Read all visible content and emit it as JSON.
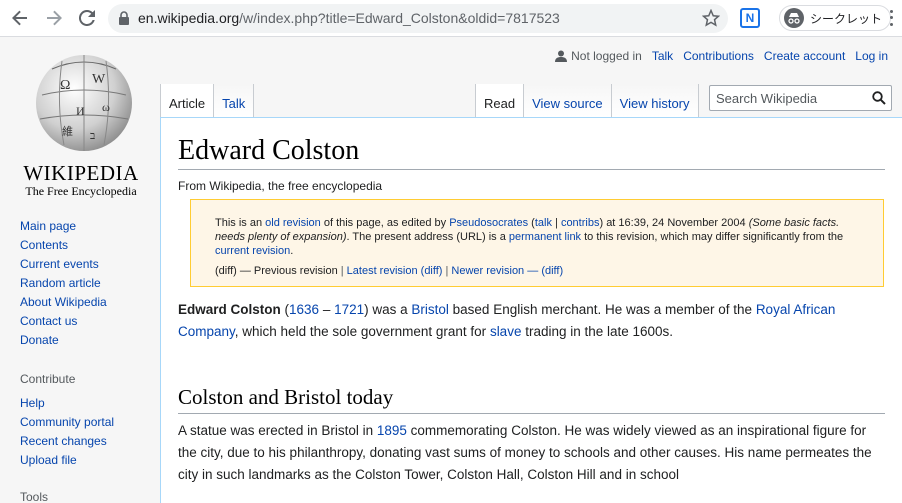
{
  "browser": {
    "url_domain": "en.wikipedia.org",
    "url_path": "/w/index.php?title=Edward_Colston&oldid=7817523",
    "incognito_label": "シークレット",
    "extension_label": "N"
  },
  "logo": {
    "wordmark": "WIKIPEDIA",
    "tagline": "The Free Encyclopedia"
  },
  "sidebar": {
    "navigation": [
      "Main page",
      "Contents",
      "Current events",
      "Random article",
      "About Wikipedia",
      "Contact us",
      "Donate"
    ],
    "contribute_heading": "Contribute",
    "contribute": [
      "Help",
      "Community portal",
      "Recent changes",
      "Upload file"
    ],
    "tools_heading": "Tools"
  },
  "personal": {
    "not_logged_in": "Not logged in",
    "talk": "Talk",
    "contributions": "Contributions",
    "create_account": "Create account",
    "log_in": "Log in"
  },
  "tabs": {
    "article": "Article",
    "talk": "Talk",
    "read": "Read",
    "view_source": "View source",
    "view_history": "View history"
  },
  "search": {
    "placeholder": "Search Wikipedia"
  },
  "article": {
    "title": "Edward Colston",
    "site_sub": "From Wikipedia, the free encyclopedia",
    "notice": {
      "t1": "This is an ",
      "old_revision": "old revision",
      "t2": " of this page, as edited by ",
      "editor": "Pseudosocrates",
      "t3": " (",
      "talk": "talk",
      "t4": " | ",
      "contribs": "contribs",
      "t5": ") at 16:39, 24 November 2004 ",
      "summary": "(Some basic facts. needs plenty of expansion)",
      "t6": ". The present address (URL) is a ",
      "permanent_link": "permanent link",
      "t7": " to this revision, which may differ significantly from the ",
      "current_revision": "current revision",
      "t8": ".",
      "diff1": "(diff)",
      "prev": " — Previous revision ",
      "pipe": "|",
      "latest": " Latest revision",
      "diff2": " (diff)",
      "newer": " Newer revision",
      "dash": " — ",
      "diff3": "(diff)"
    },
    "lead": {
      "name": "Edward Colston",
      "open": " (",
      "born": "1636",
      "dash": " – ",
      "died": "1721",
      "t1": ") was a ",
      "bristol": "Bristol",
      "t2": " based English merchant. He was a member of the ",
      "rac": "Royal African Company",
      "t3": ", which held the sole government grant for ",
      "slave": "slave",
      "t4": " trading in the late 1600s."
    },
    "section_heading": "Colston and Bristol today",
    "section_para": {
      "t1": "A statue was erected in Bristol in ",
      "year": "1895",
      "t2": " commemorating Colston. He was widely viewed as an inspirational figure for the city, due to his philanthropy, donating vast sums of money to schools and other causes. His name permeates the city in such landmarks as the Colston Tower, Colston Hall, Colston Hill and in school"
    }
  }
}
